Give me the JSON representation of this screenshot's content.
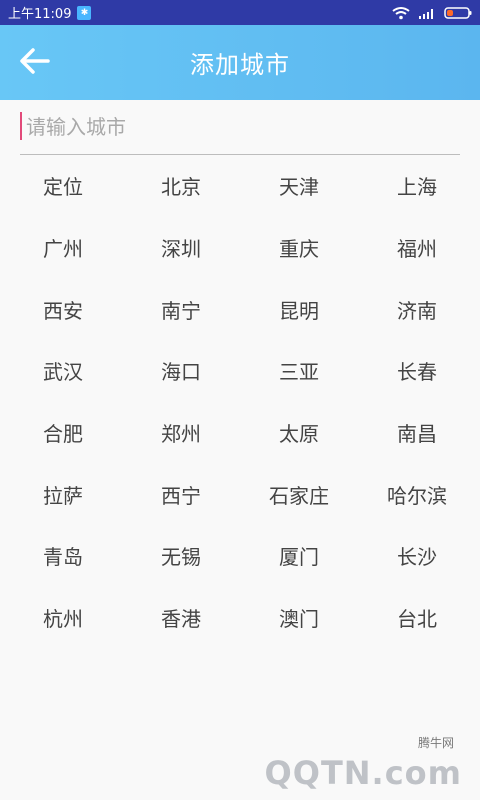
{
  "status_bar": {
    "time": "上午11:09",
    "notify_glyph": "✱"
  },
  "header": {
    "title": "添加城市"
  },
  "search": {
    "placeholder": "请输入城市"
  },
  "cities": [
    "定位",
    "北京",
    "天津",
    "上海",
    "广州",
    "深圳",
    "重庆",
    "福州",
    "西安",
    "南宁",
    "昆明",
    "济南",
    "武汉",
    "海口",
    "三亚",
    "长春",
    "合肥",
    "郑州",
    "太原",
    "南昌",
    "拉萨",
    "西宁",
    "石家庄",
    "哈尔滨",
    "青岛",
    "无锡",
    "厦门",
    "长沙",
    "杭州",
    "香港",
    "澳门",
    "台北"
  ],
  "watermark": {
    "small": "腾牛网",
    "main": "QQTN.com"
  },
  "colors": {
    "status_bar": "#2f3aa6",
    "appbar_start": "#68c7f6",
    "appbar_end": "#5bb6ef",
    "caret": "#e24a7a"
  },
  "icons": {
    "back": "arrow-left-icon",
    "wifi": "wifi-icon",
    "signal": "signal-icon",
    "battery": "battery-icon"
  }
}
